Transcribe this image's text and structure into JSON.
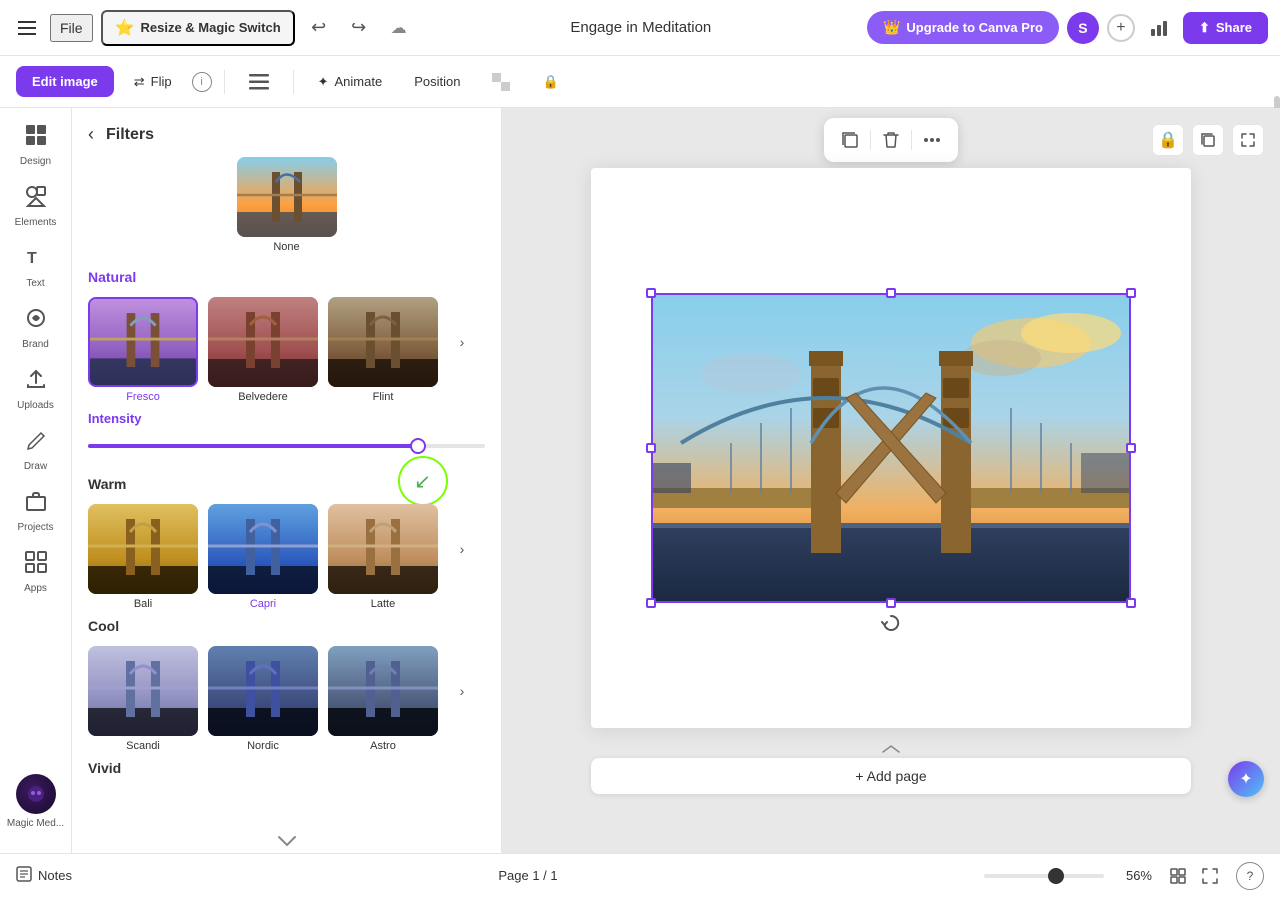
{
  "topbar": {
    "file_label": "File",
    "resize_magic_label": "Resize & Magic Switch",
    "title": "Engage in Meditation",
    "upgrade_label": "Upgrade to Canva Pro",
    "share_label": "Share",
    "avatar_letter": "S"
  },
  "secondary_toolbar": {
    "edit_image_label": "Edit image",
    "flip_label": "Flip",
    "animate_label": "Animate",
    "position_label": "Position"
  },
  "filters_panel": {
    "title": "Filters",
    "none_label": "None",
    "natural_section": "Natural",
    "warm_section": "Warm",
    "cool_section": "Cool",
    "vivid_section": "Vivid",
    "intensity_label": "Intensity",
    "natural_filters": [
      {
        "name": "Fresco",
        "selected": true
      },
      {
        "name": "Belvedere",
        "selected": false
      },
      {
        "name": "Flint",
        "selected": false
      }
    ],
    "warm_filters": [
      {
        "name": "Bali",
        "selected": false
      },
      {
        "name": "Capri",
        "selected": false
      },
      {
        "name": "Latte",
        "selected": false
      }
    ],
    "cool_filters": [
      {
        "name": "Scandi",
        "selected": false
      },
      {
        "name": "Nordic",
        "selected": false
      },
      {
        "name": "Astro",
        "selected": false
      }
    ]
  },
  "sidebar": {
    "items": [
      {
        "label": "Design",
        "icon": "grid"
      },
      {
        "label": "Elements",
        "icon": "shapes"
      },
      {
        "label": "Text",
        "icon": "text"
      },
      {
        "label": "Brand",
        "icon": "brand"
      },
      {
        "label": "Uploads",
        "icon": "upload"
      },
      {
        "label": "Draw",
        "icon": "draw"
      },
      {
        "label": "Projects",
        "icon": "folder"
      },
      {
        "label": "Apps",
        "icon": "apps"
      },
      {
        "label": "Magic Med...",
        "icon": "magic"
      }
    ]
  },
  "canvas": {
    "floating_toolbar": {
      "copy_icon": "⧉",
      "delete_icon": "🗑",
      "more_icon": "···"
    }
  },
  "bottombar": {
    "notes_label": "Notes",
    "page_info": "Page 1 / 1",
    "zoom_level": "56%",
    "add_page_label": "+ Add page"
  }
}
